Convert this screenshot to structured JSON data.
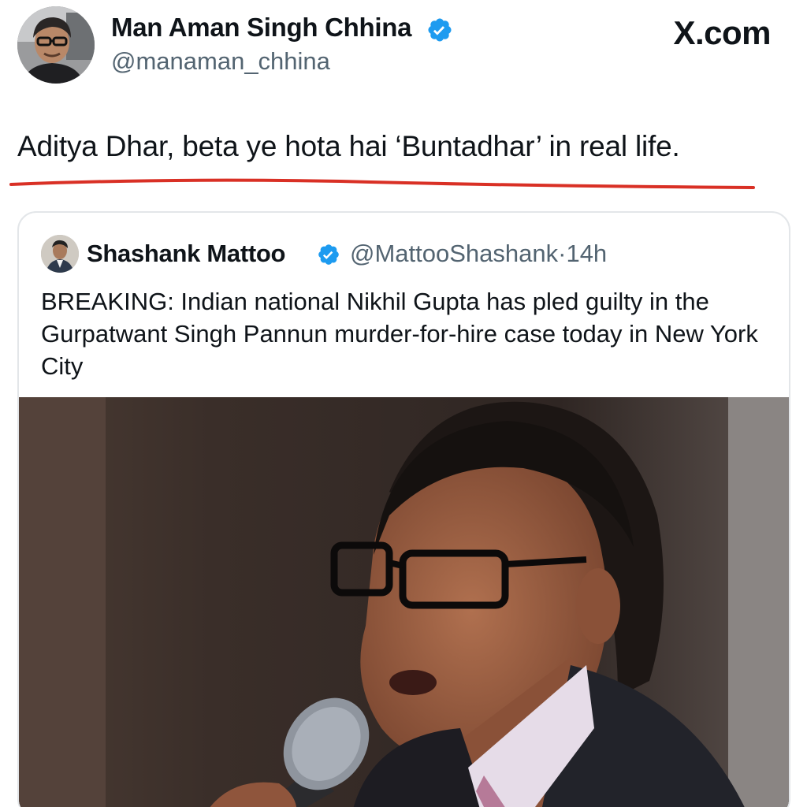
{
  "author": {
    "name": "Man Aman Singh Chhina",
    "handle": "@manaman_chhina",
    "verified": true
  },
  "brand": "X.com",
  "tweet": {
    "text": "Aditya Dhar, beta ye hota hai ‘Buntadhar’ in real life."
  },
  "quoted": {
    "name": "Shashank Mattoo",
    "handle": "@MattooShashank",
    "separator": "·",
    "time": "14h",
    "verified": true,
    "text": "BREAKING: Indian national Nikhil Gupta has pled guilty in the Gurpatwant Singh Pannun murder-for-hire case today in New York City"
  },
  "colors": {
    "verified": "#1d9bf0",
    "underline": "#d93025",
    "secondary_text": "#536471",
    "border": "#e3e6e9"
  }
}
